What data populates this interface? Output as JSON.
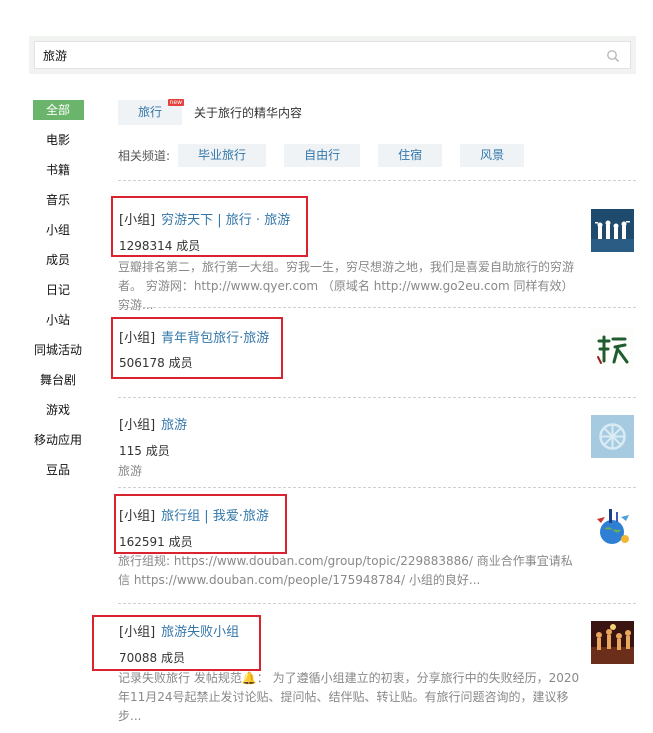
{
  "search": {
    "query": "旅游"
  },
  "sidebar": {
    "items": [
      "全部",
      "电影",
      "书籍",
      "音乐",
      "小组",
      "成员",
      "日记",
      "小站",
      "同城活动",
      "舞台剧",
      "游戏",
      "移动应用",
      "豆品"
    ]
  },
  "topic": {
    "tag": "旅行",
    "badge": "new",
    "description": "关于旅行的精华内容"
  },
  "related": {
    "label": "相关频道:",
    "channels": [
      "毕业旅行",
      "自由行",
      "住宿",
      "风景"
    ]
  },
  "results": [
    {
      "prefix": "[小组]",
      "title": "穷游天下 | 旅行 · 旅游",
      "members": "1298314 成员",
      "desc": "豆瓣排名第二，旅行第一大组。穷我一生，穷尽想游之地，我们是喜爱自助旅行的穷游者。 穷游网：http://www.qyer.com （原域名 http://www.go2eu.com 同样有效） 穷游..."
    },
    {
      "prefix": "[小组]",
      "title": "青年背包旅行·旅游",
      "members": "506178 成员",
      "desc": ""
    },
    {
      "prefix": "[小组]",
      "title": "旅游",
      "members": "115 成员",
      "desc": "旅游"
    },
    {
      "prefix": "[小组]",
      "title": "旅行组 | 我爱·旅游",
      "members": "162591 成员",
      "desc": "旅行组规: https://www.douban.com/group/topic/229883886/ 商业合作事宜请私信 https://www.douban.com/people/175948784/ 小组的良好..."
    },
    {
      "prefix": "[小组]",
      "title": "旅游失败小组",
      "members": "70088 成员",
      "desc": "记录失败旅行 发帖规范🔔： 为了遵循小组建立的初衷，分享旅行中的失败经历，2020年11月24号起禁止发讨论贴、提问帖、结伴贴、转让贴。有旅行问题咨询的，建议移步..."
    }
  ],
  "colors": {
    "accent_green": "#6ab56b",
    "link_blue": "#3377aa",
    "highlight_red": "#d9232e"
  }
}
